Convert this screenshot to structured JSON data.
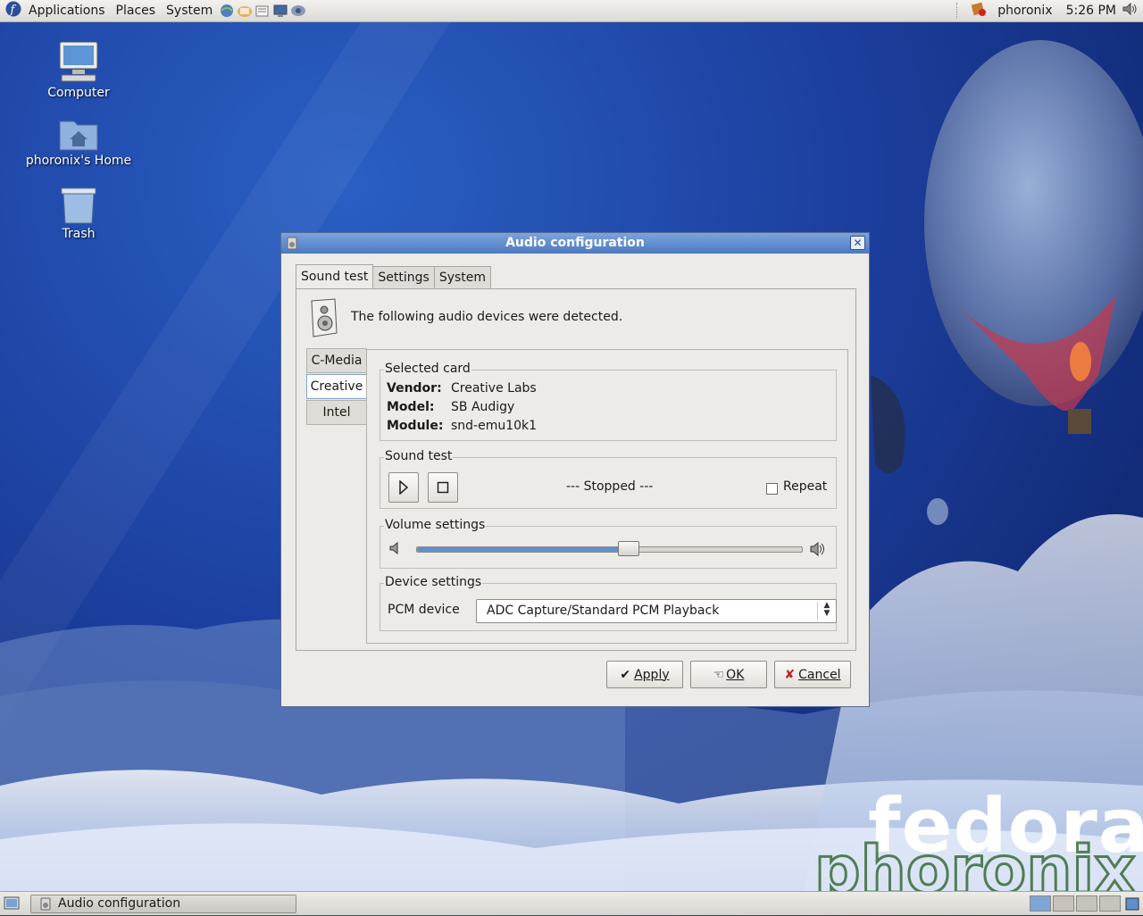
{
  "top_panel": {
    "menus": [
      "Applications",
      "Places",
      "System"
    ],
    "launchers": [
      "web-browser-icon",
      "mail-icon",
      "text-editor-icon",
      "monitor-icon",
      "network-icon"
    ],
    "username": "phoronix",
    "clock": "5:26 PM"
  },
  "desktop_icons": [
    {
      "label": "Computer",
      "icon": "computer-icon"
    },
    {
      "label": "phoronix's Home",
      "icon": "home-folder-icon"
    },
    {
      "label": "Trash",
      "icon": "trash-icon"
    }
  ],
  "window": {
    "title": "Audio configuration",
    "tabs": [
      "Sound test",
      "Settings",
      "System"
    ],
    "active_tab": "Sound test",
    "intro": "The following audio devices were detected.",
    "cards": [
      "C-Media",
      "Creative",
      "Intel"
    ],
    "active_card": "Creative",
    "selected_card": {
      "label": "Selected card",
      "vendor_label": "Vendor:",
      "vendor": "Creative Labs",
      "model_label": "Model:",
      "model": "SB Audigy",
      "module_label": "Module:",
      "module": "snd-emu10k1"
    },
    "sound_test": {
      "label": "Sound test",
      "status": "--- Stopped ---",
      "repeat_label": "Repeat",
      "repeat_checked": false
    },
    "volume": {
      "label": "Volume settings",
      "level": 0.55
    },
    "device_settings": {
      "label": "Device settings",
      "pcm_label": "PCM device",
      "pcm_value": "ADC Capture/Standard PCM Playback"
    },
    "buttons": {
      "apply": "Apply",
      "ok": "OK",
      "cancel": "Cancel"
    }
  },
  "taskbar": {
    "task_label": "Audio configuration"
  },
  "branding": {
    "distro": "fedora",
    "watermark": "phoronix"
  },
  "colors": {
    "accent": "#4c79c0",
    "desktop": "#1c3f9e"
  }
}
